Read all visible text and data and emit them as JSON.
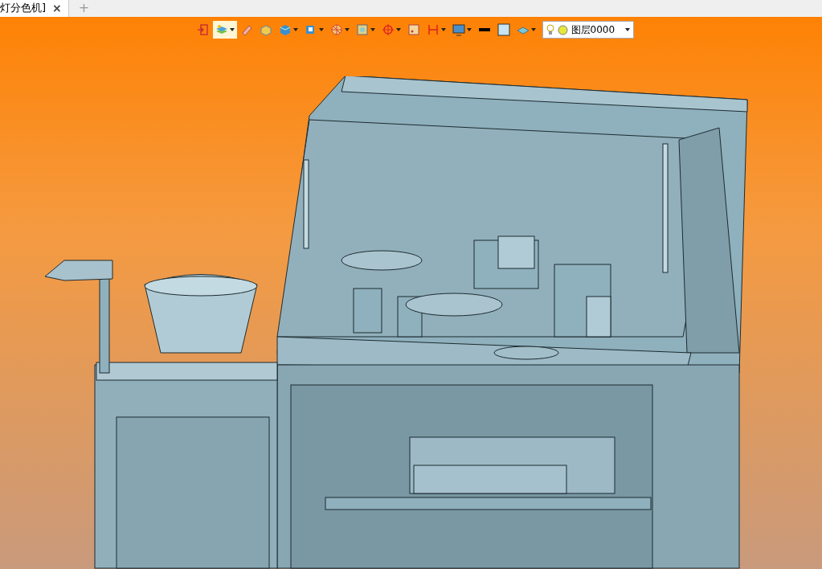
{
  "tabs": [
    {
      "title": "灯分色机]",
      "close": "×"
    }
  ],
  "new_tab": "+",
  "layer_select": {
    "value": "图层0000"
  }
}
